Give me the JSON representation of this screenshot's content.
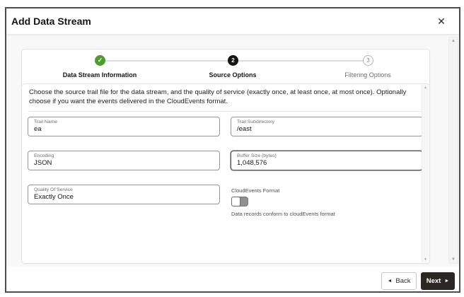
{
  "dialog": {
    "title": "Add Data Stream"
  },
  "icons": {
    "close": "✕",
    "check": "✓",
    "back_arrow": "◄",
    "next_arrow": "►",
    "scroll_up": "▲",
    "scroll_down": "▼"
  },
  "stepper": {
    "steps": [
      {
        "label": "Data Stream Information",
        "state": "complete",
        "symbol": "✓"
      },
      {
        "label": "Source Options",
        "state": "current",
        "symbol": "2"
      },
      {
        "label": "Filtering Options",
        "state": "upcoming",
        "symbol": "3"
      }
    ]
  },
  "form": {
    "instructions": "Choose the source trail file for the data stream, and the quality of service (exactly once, at least once, at most once). Optionally choose if you want the events delivered in the CloudEvents format.",
    "fields": {
      "trail_name": {
        "label": "Trail Name",
        "value": "ea"
      },
      "trail_subdirectory": {
        "label": "Trail Subdirectory",
        "value": "/east"
      },
      "encoding": {
        "label": "Encoding",
        "value": "JSON"
      },
      "buffer_size": {
        "label": "Buffer Size (bytes)",
        "value": "1,048,576"
      },
      "quality_of_service": {
        "label": "Quality Of Service",
        "value": "Exactly Once"
      },
      "cloudevents": {
        "label": "CloudEvents Format",
        "state": "off",
        "helper": "Data records conform to cloudEvents format"
      }
    }
  },
  "footer": {
    "back_label": "Back",
    "next_label": "Next"
  },
  "colors": {
    "step_complete": "#4e9c2d",
    "step_current": "#161513",
    "next_button_bg": "#2b2723",
    "body_bg": "#f8f8f8"
  }
}
